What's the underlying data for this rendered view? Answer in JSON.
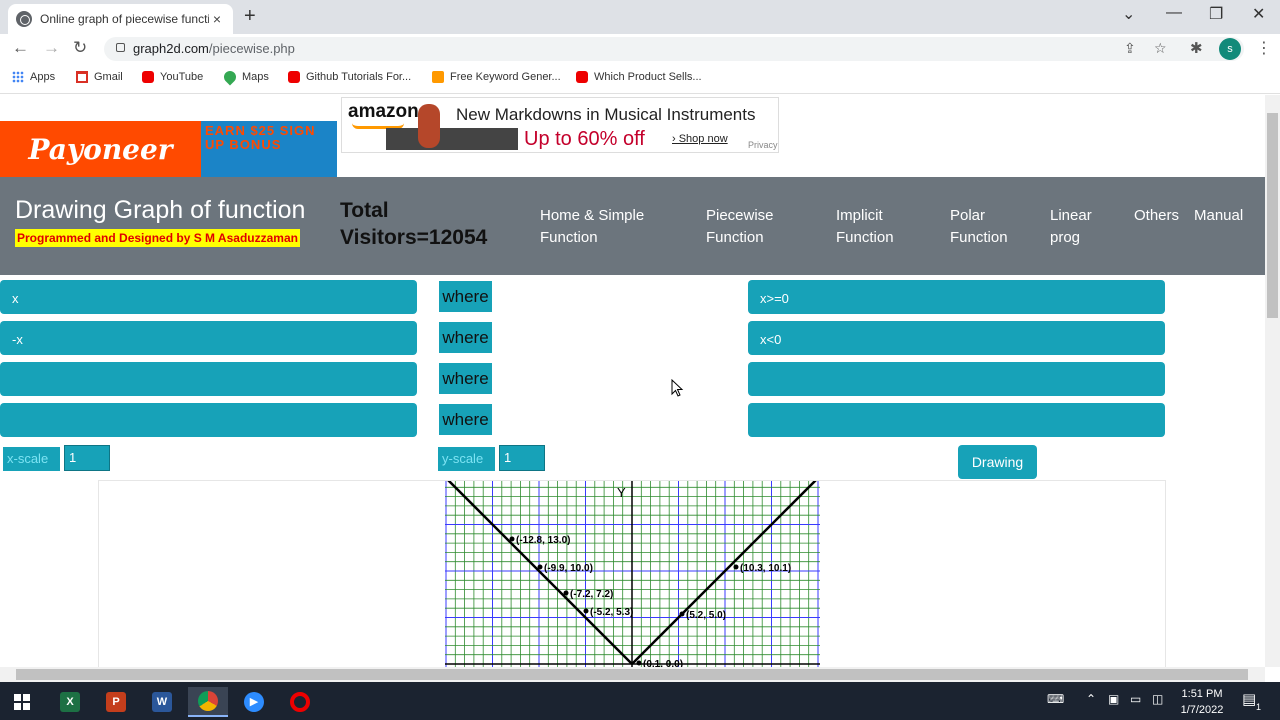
{
  "browser": {
    "tab_title": "Online graph of piecewise functi",
    "tab_close": "×",
    "new_tab": "+",
    "url_domain": "graph2d.com",
    "url_path": "/piecewise.php",
    "avatar_letter": "s",
    "bookmarks": [
      "Apps",
      "Gmail",
      "YouTube",
      "Maps",
      "Github Tutorials For...",
      "Free Keyword Gener...",
      "Which Product Sells..."
    ]
  },
  "ads": {
    "payoneer_logo": "Payoneer",
    "payoneer_promo": "EARN $25 SIGN UP BONUS",
    "amazon_logo": "amazon",
    "amazon_headline": "New Markdowns in Musical Instruments",
    "amazon_offer": "Up to 60% off",
    "amazon_shop": "› Shop now",
    "amazon_privacy": "Privacy"
  },
  "header": {
    "title": "Drawing Graph of function",
    "byline": "Programmed and Designed by S M Asaduzzaman",
    "visitors_line1": "Total",
    "visitors_line2": "Visitors=12054",
    "nav": [
      {
        "l1": "Home & Simple",
        "l2": "Function"
      },
      {
        "l1": "Piecewise",
        "l2": "Function"
      },
      {
        "l1": "Implicit",
        "l2": "Function"
      },
      {
        "l1": "Polar",
        "l2": "Function"
      },
      {
        "l1": "Linear",
        "l2": "prog"
      },
      {
        "l1": "Others",
        "l2": ""
      },
      {
        "l1": "Manual",
        "l2": ""
      }
    ]
  },
  "form": {
    "where_label": "where",
    "rows": [
      {
        "func": "x",
        "cond": "x>=0"
      },
      {
        "func": "-x",
        "cond": "x<0"
      },
      {
        "func": "",
        "cond": ""
      },
      {
        "func": "",
        "cond": ""
      }
    ],
    "x_scale_label": "x-scale",
    "x_scale_value": "1",
    "y_scale_label": "y-scale",
    "y_scale_value": "1",
    "draw_button": "Drawing"
  },
  "graph": {
    "y_axis_label": "Y",
    "points": [
      {
        "label": "(-12.8, 13.0)"
      },
      {
        "label": "(-9.9, 10.0)"
      },
      {
        "label": "(-7.2, 7.2)"
      },
      {
        "label": "(-5.2, 5.3)"
      },
      {
        "label": "(5.2, 5.0)"
      },
      {
        "label": "(10.3, 10.1)"
      },
      {
        "label": "(0.1, 0.0)"
      }
    ]
  },
  "taskbar": {
    "time": "1:51 PM",
    "date": "1/7/2022",
    "notification_count": "1"
  }
}
